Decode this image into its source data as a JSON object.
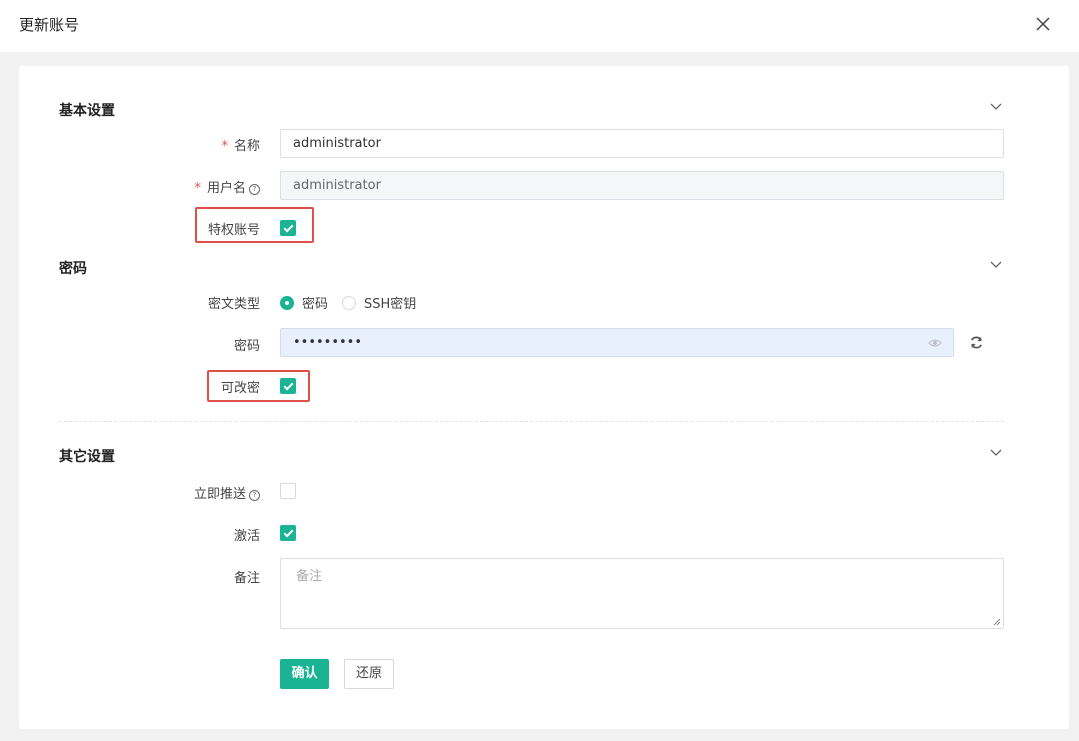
{
  "dialog": {
    "title": "更新账号"
  },
  "colors": {
    "accent": "#1ab394",
    "highlight": "#e0504a",
    "required": "#e0504a"
  },
  "sections": {
    "basic": {
      "title": "基本设置",
      "name": {
        "label": "名称",
        "value": "administrator"
      },
      "username": {
        "label": "用户名",
        "value": "administrator"
      },
      "privileged": {
        "label": "特权账号",
        "checked": true
      }
    },
    "password": {
      "title": "密码",
      "secret_type": {
        "label": "密文类型",
        "options": [
          "密码",
          "SSH密钥"
        ],
        "selected": "密码"
      },
      "password": {
        "label": "密码",
        "value": "•••••••••"
      },
      "changeable": {
        "label": "可改密",
        "checked": true
      }
    },
    "other": {
      "title": "其它设置",
      "push_now": {
        "label": "立即推送",
        "checked": false
      },
      "active": {
        "label": "激活",
        "checked": true
      },
      "comment": {
        "label": "备注",
        "placeholder": "备注"
      }
    }
  },
  "buttons": {
    "confirm": "确认",
    "reset": "还原"
  },
  "help_icon_glyph": "?"
}
